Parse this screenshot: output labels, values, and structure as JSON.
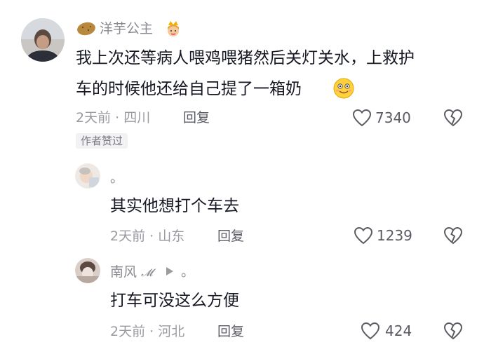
{
  "comments": [
    {
      "username": "洋芋公主",
      "text_line1": "我上次还等病人喂鸡喂猪然后关灯关水，上救护",
      "text_line2": "车的时候他还给自己提了一箱奶",
      "time": "2天前",
      "location": "四川",
      "reply_label": "回复",
      "likes": "7340",
      "author_badge": "作者赞过",
      "name_icons": [
        "potato-emoji",
        "princess-emoji"
      ],
      "inline_emoji": "smile-emoji"
    },
    {
      "username": "。",
      "text": "其实他想打个车去",
      "time": "2天前",
      "location": "山东",
      "reply_label": "回复",
      "likes": "1239"
    },
    {
      "username": "南风",
      "username_suffix": "𝓜",
      "reply_to": "。",
      "text": "打车可没这么方便",
      "time": "2天前",
      "location": "河北",
      "reply_label": "回复",
      "likes": "424"
    }
  ],
  "separator": "·",
  "icons": [
    "heart-icon",
    "broken-heart-icon",
    "reply-arrow-icon"
  ],
  "colors": {
    "text": "#161823",
    "secondary": "#8a8b91",
    "badge_bg": "#f2f2f4"
  }
}
